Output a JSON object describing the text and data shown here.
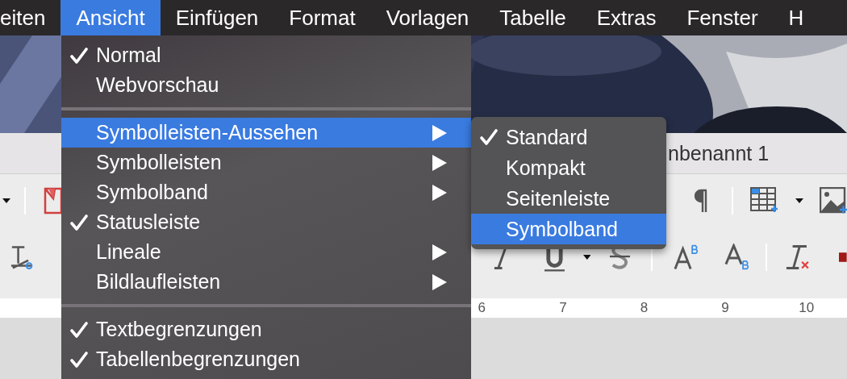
{
  "menubar": {
    "items": [
      {
        "label": "eiten",
        "selected": false
      },
      {
        "label": "Ansicht",
        "selected": true
      },
      {
        "label": "Einfügen",
        "selected": false
      },
      {
        "label": "Format",
        "selected": false
      },
      {
        "label": "Vorlagen",
        "selected": false
      },
      {
        "label": "Tabelle",
        "selected": false
      },
      {
        "label": "Extras",
        "selected": false
      },
      {
        "label": "Fenster",
        "selected": false
      },
      {
        "label": "H",
        "selected": false
      }
    ]
  },
  "window": {
    "title": "nbenannt 1",
    "ruler": [
      "6",
      "7",
      "8",
      "9",
      "10"
    ]
  },
  "menu": {
    "items": [
      {
        "kind": "item",
        "label": "Normal",
        "checked": true,
        "submenu": false,
        "selected": false
      },
      {
        "kind": "item",
        "label": "Webvorschau",
        "checked": false,
        "submenu": false,
        "selected": false
      },
      {
        "kind": "separator"
      },
      {
        "kind": "item",
        "label": "Symbolleisten-Aussehen",
        "checked": false,
        "submenu": true,
        "selected": true
      },
      {
        "kind": "item",
        "label": "Symbolleisten",
        "checked": false,
        "submenu": true,
        "selected": false
      },
      {
        "kind": "item",
        "label": "Symbolband",
        "checked": false,
        "submenu": true,
        "selected": false
      },
      {
        "kind": "item",
        "label": "Statusleiste",
        "checked": true,
        "submenu": false,
        "selected": false
      },
      {
        "kind": "item",
        "label": "Lineale",
        "checked": false,
        "submenu": true,
        "selected": false
      },
      {
        "kind": "item",
        "label": "Bildlaufleisten",
        "checked": false,
        "submenu": true,
        "selected": false
      },
      {
        "kind": "separator"
      },
      {
        "kind": "item",
        "label": "Textbegrenzungen",
        "checked": true,
        "submenu": false,
        "selected": false
      },
      {
        "kind": "item",
        "label": "Tabellenbegrenzungen",
        "checked": true,
        "submenu": false,
        "selected": false
      }
    ]
  },
  "submenu": {
    "items": [
      {
        "label": "Standard",
        "checked": true,
        "selected": false
      },
      {
        "label": "Kompakt",
        "checked": false,
        "selected": false
      },
      {
        "label": "Seitenleiste",
        "checked": false,
        "selected": false
      },
      {
        "label": "Symbolband",
        "checked": false,
        "selected": true
      }
    ]
  }
}
